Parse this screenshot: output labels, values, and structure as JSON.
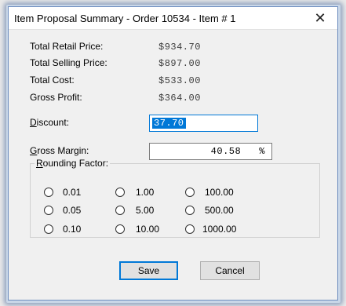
{
  "window": {
    "title": "Item Proposal Summary - Order 10534 - Item # 1",
    "close_glyph": "✕"
  },
  "summary": {
    "total_retail_price": {
      "label": "Total Retail Price:",
      "value": "$934.70"
    },
    "total_selling_price": {
      "label": "Total Selling Price:",
      "value": "$897.00"
    },
    "total_cost": {
      "label": "Total Cost:",
      "value": "$533.00"
    },
    "gross_profit": {
      "label": "Gross Profit:",
      "value": "$364.00"
    }
  },
  "discount": {
    "label_mnemonic": "D",
    "label_rest": "iscount:",
    "value": "37.70"
  },
  "gross_margin": {
    "label_mnemonic": "G",
    "label_rest": "ross Margin:",
    "value": "40.58",
    "unit": "%"
  },
  "rounding": {
    "label_mnemonic": "R",
    "label_rest": "ounding Factor:",
    "options": [
      "0.01",
      "1.00",
      "100.00",
      "0.05",
      "5.00",
      "500.00",
      "0.10",
      "10.00",
      "1000.00"
    ],
    "selected": null
  },
  "buttons": {
    "save": "Save",
    "cancel": "Cancel"
  },
  "colors": {
    "accent": "#0078d7",
    "window_border": "#6d8dbf",
    "background": "#f0f0f0"
  }
}
